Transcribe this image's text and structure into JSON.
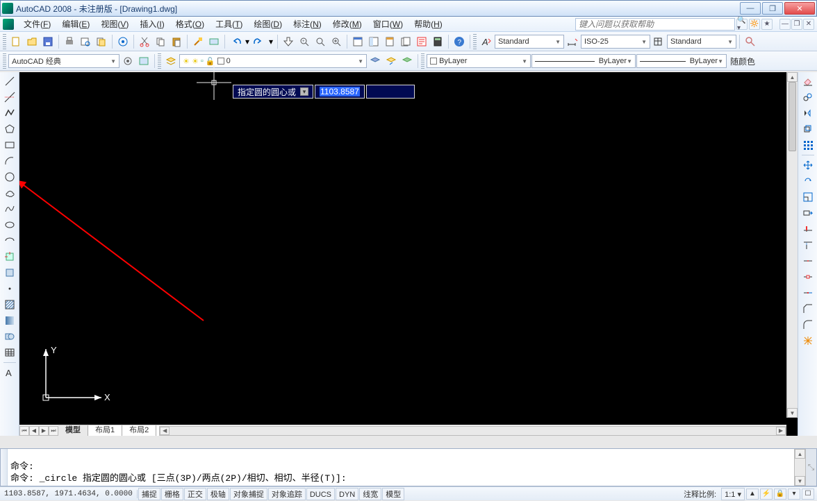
{
  "title": "AutoCAD 2008 - 未注册版 - [Drawing1.dwg]",
  "menu": {
    "items": [
      {
        "label": "文件",
        "key": "F"
      },
      {
        "label": "编辑",
        "key": "E"
      },
      {
        "label": "视图",
        "key": "V"
      },
      {
        "label": "插入",
        "key": "I"
      },
      {
        "label": "格式",
        "key": "O"
      },
      {
        "label": "工具",
        "key": "T"
      },
      {
        "label": "绘图",
        "key": "D"
      },
      {
        "label": "标注",
        "key": "N"
      },
      {
        "label": "修改",
        "key": "M"
      },
      {
        "label": "窗口",
        "key": "W"
      },
      {
        "label": "帮助",
        "key": "H"
      }
    ],
    "help_placeholder": "键入问题以获取帮助"
  },
  "toolbar1": {
    "text_style": "Standard",
    "dim_style": "ISO-25",
    "table_style": "Standard"
  },
  "toolbar2": {
    "workspace": "AutoCAD 经典",
    "layer_combo": "0",
    "layer_prop": "ByLayer",
    "linetype": "ByLayer",
    "lineweight": "ByLayer",
    "plotstyle_label": "随颜色"
  },
  "canvas": {
    "tabs": {
      "model": "模型",
      "layout1": "布局1",
      "layout2": "布局2"
    },
    "dynamic_input": {
      "label": "指定圆的圆心或",
      "value": "1103.8587"
    },
    "ucs": {
      "x": "X",
      "y": "Y"
    }
  },
  "command": {
    "line1": "命令:",
    "line2": "命令: _circle 指定圆的圆心或 [三点(3P)/两点(2P)/相切、相切、半径(T)]:"
  },
  "status": {
    "coords": "1103.8587, 1971.4634, 0.0000",
    "toggles": [
      "捕捉",
      "栅格",
      "正交",
      "极轴",
      "对象捕捉",
      "对象追踪",
      "DUCS",
      "DYN",
      "线宽",
      "模型"
    ],
    "anno_label": "注释比例:",
    "anno_scale": "1:1"
  },
  "icons": {
    "line": "line-icon",
    "ray": "construction-line-icon",
    "pline": "polyline-icon",
    "polygon": "polygon-icon",
    "rect": "rectangle-icon",
    "arc": "arc-icon",
    "circle": "circle-icon",
    "revcloud": "revcloud-icon",
    "spline": "spline-icon",
    "ellipse": "ellipse-icon",
    "ellipsearc": "ellipse-arc-icon",
    "block": "insert-block-icon",
    "makeblock": "make-block-icon",
    "point": "point-icon",
    "hatch": "hatch-icon",
    "gradient": "gradient-icon",
    "region": "region-icon",
    "table": "table-icon",
    "text": "mtext-icon",
    "erase": "erase-icon",
    "copy": "copy-icon",
    "mirror": "mirror-icon",
    "offset": "offset-icon",
    "array": "array-icon",
    "move": "move-icon",
    "rotate": "rotate-icon",
    "scale": "scale-icon",
    "stretch": "stretch-icon",
    "trim": "trim-icon",
    "extend": "extend-icon",
    "break": "break-at-point-icon",
    "break2": "break-icon",
    "join": "join-icon",
    "chamfer": "chamfer-icon",
    "fillet": "fillet-icon",
    "explode": "explode-icon"
  }
}
